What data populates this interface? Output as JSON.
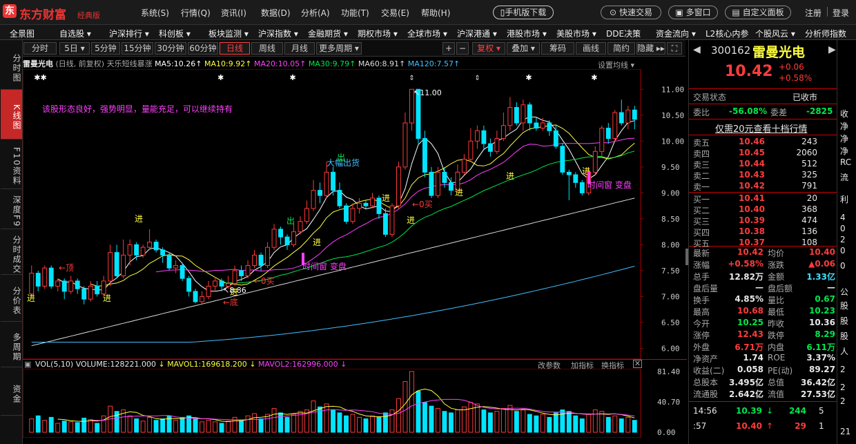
{
  "topbar": {
    "logo_icon": "东",
    "logo_text": "东方财富",
    "logo_sub": "经典版",
    "menus": [
      "系统(S)",
      "行情(Q)",
      "资讯(I)",
      "数据(D)",
      "分析(A)",
      "功能(T)",
      "交易(E)",
      "帮助(H)"
    ],
    "mobile_download": "手机版下载",
    "quick_trade": "快速交易",
    "multi_window": "多窗口",
    "custom_panel": "自定义面板",
    "register": "注册",
    "login": "登录"
  },
  "navbar": [
    "全景图",
    "自选股 ▾",
    "沪深排行 ▾",
    "科创板 ▾",
    "板块监测 ▾",
    "沪深指数 ▾",
    "金融期货 ▾",
    "期权市场 ▾",
    "全球市场 ▾",
    "沪深港通 ▾",
    "港股市场 ▾",
    "美股市场 ▾",
    "DDE决策",
    "资金流向 ▾",
    "L2核心内参",
    "个股风云 ▾",
    "分析师指数"
  ],
  "lefttabs": [
    {
      "label": "分时图",
      "active": false
    },
    {
      "label": "K线图",
      "active": true
    },
    {
      "label": "F10资料",
      "active": false
    },
    {
      "label": "深度F9",
      "active": false
    },
    {
      "label": "分时成交",
      "active": false
    },
    {
      "label": "分价表",
      "active": false
    },
    {
      "label": "多周期",
      "active": false
    },
    {
      "label": "资金",
      "active": false
    }
  ],
  "timeframes": [
    "分时",
    "5日 ▾",
    "5分钟",
    "15分钟",
    "30分钟",
    "60分钟",
    "日线",
    "周线",
    "月线",
    "更多周期 ▾"
  ],
  "timeframe_active": "日线",
  "tools": [
    "+",
    "−",
    "复权 ▾",
    "叠加 ▾",
    "筹码",
    "画线",
    "简约",
    "隐藏 ▸▸",
    "⛶"
  ],
  "ma_bar": {
    "name": "雷曼光电",
    "mode": "(日线, 前复权)",
    "indicator": "天乐短线暴涨",
    "ma5": "MA5:10.26",
    "ma10": "MA10:9.92",
    "ma20": "MA20:10.05",
    "ma30": "MA30:9.79",
    "ma60": "MA60:8.91",
    "ma120": "MA120:7.57",
    "settings": "设置均线 ▾"
  },
  "annotations": {
    "comment": "该股形态良好，强势明显，量能充足，可以继续持有",
    "big_sell": "大幅出货",
    "time_window1": "时间窗 变盘",
    "time_window2": "时间窗 变盘",
    "jin": "进",
    "chu": "出",
    "ding": "←顶",
    "di": "←底",
    "buy1": "←0买",
    "buy2": "←0买",
    "low_price": "8.86",
    "high_price": "11.00"
  },
  "vol_bar": {
    "label": "VOL(5,10)",
    "volume": "VOLUME:128221.000",
    "mavol1": "MAVOL1:169618.200",
    "mavol2": "MAVOL2:162996.000",
    "change_param": "改参数",
    "add_indicator": "加指标",
    "switch_indicator": "换指标"
  },
  "colors": {
    "up": "#ff3b3b",
    "down": "#00e5ff",
    "ma5": "#ffffff",
    "ma10": "#ffff40",
    "ma20": "#ff40ff",
    "ma30": "#00e64d",
    "ma60": "#dddddd",
    "ma120": "#40c0ff"
  },
  "chart_data": {
    "type": "candlestick",
    "y_ticks": [
      "11.00",
      "10.50",
      "10.00",
      "9.50",
      "9.00",
      "8.50",
      "8.00",
      "7.50",
      "7.00",
      "6.50",
      "6.00"
    ],
    "ylim": [
      5.9,
      11.15
    ],
    "vol_ticks": [
      "81.40",
      "40.70",
      "0.00"
    ],
    "vol_ylim": [
      0,
      81.4
    ],
    "candles": [
      [
        7.05,
        7.45,
        7.6,
        7.0
      ],
      [
        7.45,
        7.2,
        7.5,
        7.1
      ],
      [
        7.2,
        7.55,
        7.6,
        7.15
      ],
      [
        7.55,
        7.2,
        7.6,
        7.15
      ],
      [
        7.2,
        7.3,
        7.35,
        7.1
      ],
      [
        7.3,
        7.1,
        7.35,
        6.95
      ],
      [
        7.1,
        7.3,
        7.4,
        7.05
      ],
      [
        7.3,
        7.15,
        7.35,
        7.05
      ],
      [
        7.15,
        6.95,
        7.2,
        6.85
      ],
      [
        6.95,
        7.2,
        7.3,
        6.9
      ],
      [
        7.2,
        7.05,
        7.3,
        7.0
      ],
      [
        7.05,
        7.3,
        7.4,
        7.0
      ],
      [
        7.3,
        7.85,
        8.0,
        7.2
      ],
      [
        7.85,
        7.4,
        8.0,
        7.35
      ],
      [
        7.4,
        7.8,
        8.1,
        7.35
      ],
      [
        7.8,
        8.0,
        8.1,
        7.6
      ],
      [
        8.0,
        7.8,
        8.05,
        7.7
      ],
      [
        7.8,
        7.95,
        8.0,
        7.75
      ],
      [
        7.95,
        8.05,
        8.3,
        7.9
      ],
      [
        8.05,
        7.9,
        8.1,
        7.85
      ],
      [
        7.9,
        7.8,
        7.95,
        7.65
      ],
      [
        7.8,
        7.55,
        7.85,
        7.5
      ],
      [
        7.55,
        7.6,
        7.7,
        7.45
      ],
      [
        7.6,
        7.35,
        7.65,
        7.3
      ],
      [
        7.35,
        7.1,
        7.4,
        7.0
      ],
      [
        7.1,
        6.9,
        7.15,
        6.87
      ],
      [
        6.9,
        7.0,
        7.1,
        6.86
      ],
      [
        7.0,
        7.2,
        7.3,
        6.95
      ],
      [
        7.2,
        7.3,
        7.35,
        7.1
      ],
      [
        7.3,
        7.2,
        7.35,
        7.1
      ],
      [
        7.2,
        7.25,
        7.4,
        7.15
      ],
      [
        7.25,
        7.5,
        7.6,
        7.2
      ],
      [
        7.5,
        7.4,
        7.6,
        7.3
      ],
      [
        7.4,
        7.6,
        7.7,
        7.35
      ],
      [
        7.6,
        7.8,
        7.9,
        7.55
      ],
      [
        7.8,
        7.6,
        7.85,
        7.5
      ],
      [
        7.6,
        7.95,
        8.05,
        7.55
      ],
      [
        7.95,
        8.3,
        8.4,
        7.9
      ],
      [
        8.3,
        8.15,
        8.35,
        8.0
      ],
      [
        8.15,
        8.0,
        8.2,
        7.9
      ],
      [
        8.0,
        8.25,
        8.4,
        7.95
      ],
      [
        8.25,
        8.45,
        8.55,
        8.2
      ],
      [
        8.45,
        8.7,
        8.85,
        8.4
      ],
      [
        8.7,
        9.05,
        9.25,
        8.65
      ],
      [
        9.05,
        8.95,
        9.2,
        8.8
      ],
      [
        8.95,
        9.4,
        9.6,
        8.9
      ],
      [
        9.4,
        9.05,
        9.5,
        8.95
      ],
      [
        9.05,
        8.75,
        9.2,
        8.7
      ],
      [
        8.75,
        8.45,
        8.8,
        8.4
      ],
      [
        8.45,
        8.7,
        8.8,
        8.4
      ],
      [
        8.7,
        8.8,
        8.9,
        8.6
      ],
      [
        8.8,
        8.75,
        8.85,
        8.7
      ],
      [
        8.75,
        8.9,
        9.0,
        8.7
      ],
      [
        8.9,
        8.6,
        8.95,
        8.5
      ],
      [
        8.6,
        8.2,
        8.7,
        8.15
      ],
      [
        8.2,
        8.75,
        8.8,
        8.15
      ],
      [
        8.75,
        9.5,
        9.6,
        8.7
      ],
      [
        9.5,
        10.35,
        10.55,
        9.45
      ],
      [
        10.35,
        11.0,
        11.0,
        10.2
      ],
      [
        11.0,
        10.05,
        11.0,
        9.95
      ],
      [
        10.05,
        9.4,
        10.2,
        9.3
      ],
      [
        9.4,
        8.95,
        9.5,
        8.9
      ],
      [
        8.95,
        9.4,
        9.5,
        8.9
      ],
      [
        9.4,
        9.2,
        9.5,
        9.1
      ],
      [
        9.2,
        9.05,
        9.3,
        8.95
      ],
      [
        9.05,
        9.4,
        9.55,
        9.0
      ],
      [
        9.4,
        9.65,
        9.75,
        9.35
      ],
      [
        9.65,
        10.0,
        10.25,
        9.6
      ],
      [
        10.0,
        10.2,
        10.3,
        9.85
      ],
      [
        10.2,
        9.95,
        10.3,
        9.85
      ],
      [
        9.95,
        9.8,
        10.05,
        9.7
      ],
      [
        9.8,
        10.05,
        10.2,
        9.75
      ],
      [
        10.05,
        10.3,
        10.55,
        10.0
      ],
      [
        10.3,
        10.65,
        10.85,
        10.2
      ],
      [
        10.65,
        10.35,
        10.75,
        10.3
      ],
      [
        10.35,
        10.7,
        10.8,
        10.2
      ],
      [
        10.7,
        10.35,
        10.75,
        10.2
      ],
      [
        10.35,
        10.25,
        10.45,
        10.2
      ],
      [
        10.25,
        10.35,
        10.45,
        10.2
      ],
      [
        10.35,
        10.2,
        10.4,
        10.1
      ],
      [
        10.2,
        9.9,
        10.3,
        9.85
      ],
      [
        9.9,
        9.4,
        9.95,
        9.35
      ],
      [
        9.4,
        9.35,
        9.45,
        8.86
      ],
      [
        9.35,
        9.2,
        9.4,
        9.1
      ],
      [
        9.2,
        9.0,
        9.25,
        8.95
      ],
      [
        9.0,
        9.4,
        9.5,
        8.95
      ],
      [
        9.4,
        9.8,
        9.9,
        9.35
      ],
      [
        9.8,
        10.25,
        10.3,
        9.7
      ],
      [
        10.25,
        10.05,
        10.35,
        9.95
      ],
      [
        10.05,
        10.55,
        10.6,
        10.0
      ],
      [
        10.55,
        10.35,
        10.8,
        10.3
      ],
      [
        10.35,
        10.6,
        10.68,
        10.23
      ],
      [
        10.6,
        10.42,
        10.68,
        10.23
      ]
    ],
    "volumes": [
      18,
      22,
      16,
      20,
      12,
      15,
      14,
      13,
      19,
      17,
      12,
      22,
      35,
      28,
      30,
      22,
      18,
      15,
      20,
      16,
      18,
      22,
      16,
      20,
      22,
      18,
      14,
      16,
      14,
      12,
      15,
      20,
      16,
      22,
      25,
      18,
      24,
      32,
      26,
      20,
      24,
      28,
      30,
      42,
      34,
      38,
      30,
      26,
      22,
      24,
      20,
      18,
      22,
      20,
      26,
      30,
      45,
      68,
      81.4,
      55,
      40,
      35,
      32,
      28,
      26,
      30,
      34,
      40,
      38,
      30,
      26,
      28,
      32,
      36,
      28,
      30,
      24,
      22,
      24,
      20,
      26,
      30,
      28,
      22,
      18,
      24,
      30,
      28,
      20,
      22,
      18,
      20,
      16
    ]
  },
  "right_panel": {
    "code": "300162",
    "name": "雷曼光电",
    "price": "10.42",
    "change": "+0.06",
    "change_pct": "+0.58%",
    "status_label": "交易状态",
    "status": "已收市",
    "weibi_label": "委比",
    "weibi": "-56.08%",
    "weicha_label": "委差",
    "weicha": "-2825",
    "level2_link": "仅需20元查看十档行情",
    "asks": [
      {
        "label": "卖五",
        "price": "10.46",
        "vol": "243"
      },
      {
        "label": "卖四",
        "price": "10.45",
        "vol": "2060"
      },
      {
        "label": "卖三",
        "price": "10.44",
        "vol": "512"
      },
      {
        "label": "卖二",
        "price": "10.43",
        "vol": "325"
      },
      {
        "label": "卖一",
        "price": "10.42",
        "vol": "791"
      }
    ],
    "bids": [
      {
        "label": "买一",
        "price": "10.41",
        "vol": "20"
      },
      {
        "label": "买二",
        "price": "10.40",
        "vol": "368"
      },
      {
        "label": "买三",
        "price": "10.39",
        "vol": "474"
      },
      {
        "label": "买四",
        "price": "10.38",
        "vol": "136"
      },
      {
        "label": "买五",
        "price": "10.37",
        "vol": "108"
      }
    ],
    "stats": [
      [
        "最新",
        "10.42",
        "均价",
        "10.40"
      ],
      [
        "涨幅",
        "+0.58%",
        "涨跌",
        "▲0.06"
      ],
      [
        "总手",
        "12.82万",
        "金额",
        "1.33亿"
      ],
      [
        "盘后量",
        "—",
        "盘后额",
        "—"
      ],
      [
        "换手",
        "4.85%",
        "量比",
        "0.67"
      ],
      [
        "最高",
        "10.68",
        "最低",
        "10.23"
      ],
      [
        "今开",
        "10.25",
        "昨收",
        "10.36"
      ],
      [
        "涨停",
        "12.43",
        "跌停",
        "8.29"
      ],
      [
        "外盘",
        "6.71万",
        "内盘",
        "6.11万"
      ],
      [
        "净资产",
        "1.74",
        "ROE",
        "3.37%"
      ],
      [
        "收益(二)",
        "0.058",
        "PE(动)",
        "89.27"
      ],
      [
        "总股本",
        "3.495亿",
        "总值",
        "36.42亿"
      ],
      [
        "流通股",
        "2.642亿",
        "流值",
        "27.53亿"
      ]
    ],
    "ticks": [
      {
        "time": "14:56",
        "price": "10.39",
        "arrow": "↓",
        "vol": "244",
        "n": "5"
      },
      {
        "time": ":57",
        "price": "10.40",
        "arrow": "↑",
        "vol": "29",
        "n": "1"
      }
    ]
  },
  "right_strip": [
    "收",
    "净",
    "净",
    "净",
    "RC",
    "流",
    "利",
    "4",
    "0",
    "2",
    "0",
    "0",
    "公",
    "股",
    "股",
    "股",
    "人",
    "2",
    "2",
    "2",
    "21"
  ]
}
